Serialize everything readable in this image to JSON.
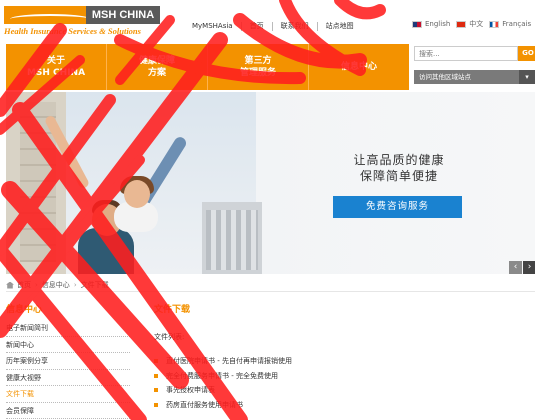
{
  "header": {
    "brand": "MSH CHINA",
    "tagline": "Health Insurance Services & Solutions",
    "topnav": [
      "MyMSHAsia",
      "首页",
      "联系我们",
      "站点地图"
    ],
    "languages": [
      {
        "label": "English",
        "flag": "flag-uk-icon"
      },
      {
        "label": "中文",
        "flag": "flag-cn-icon"
      },
      {
        "label": "Français",
        "flag": "flag-fr-icon"
      }
    ]
  },
  "mainnav": [
    {
      "line1": "关于",
      "line2": "MSH CHINA"
    },
    {
      "line1": "健康保障",
      "line2": "方案"
    },
    {
      "line1": "第三方",
      "line2": "管理服务"
    },
    {
      "line1": "信息中心",
      "line2": ""
    }
  ],
  "search": {
    "placeholder": "搜索...",
    "go": "GO"
  },
  "region": {
    "label": "访问其他区域站点"
  },
  "banner": {
    "line1": "让高品质的健康",
    "line2": "保障简单便捷",
    "button": "免费咨询服务"
  },
  "breadcrumb": [
    "首页",
    "信息中心",
    "文件下载"
  ],
  "sidebar": {
    "title": "信息中心",
    "items": [
      "电子新闻简刊",
      "新闻中心",
      "历年案例分享",
      "健康大视野",
      "文件下载",
      "会员保障"
    ],
    "active_index": 4
  },
  "content": {
    "title": "文件下载",
    "subtitle": "文件列表:",
    "files": [
      "直付医院申请书 - 先自付再申请报销使用",
      "完全付费服务申请书 - 完全免费使用",
      "事先授权申请表",
      "药房直付服务使用申请书"
    ]
  },
  "colors": {
    "accent": "#f39200",
    "button": "#1a82d0",
    "overlay": "#ff1e1e"
  }
}
